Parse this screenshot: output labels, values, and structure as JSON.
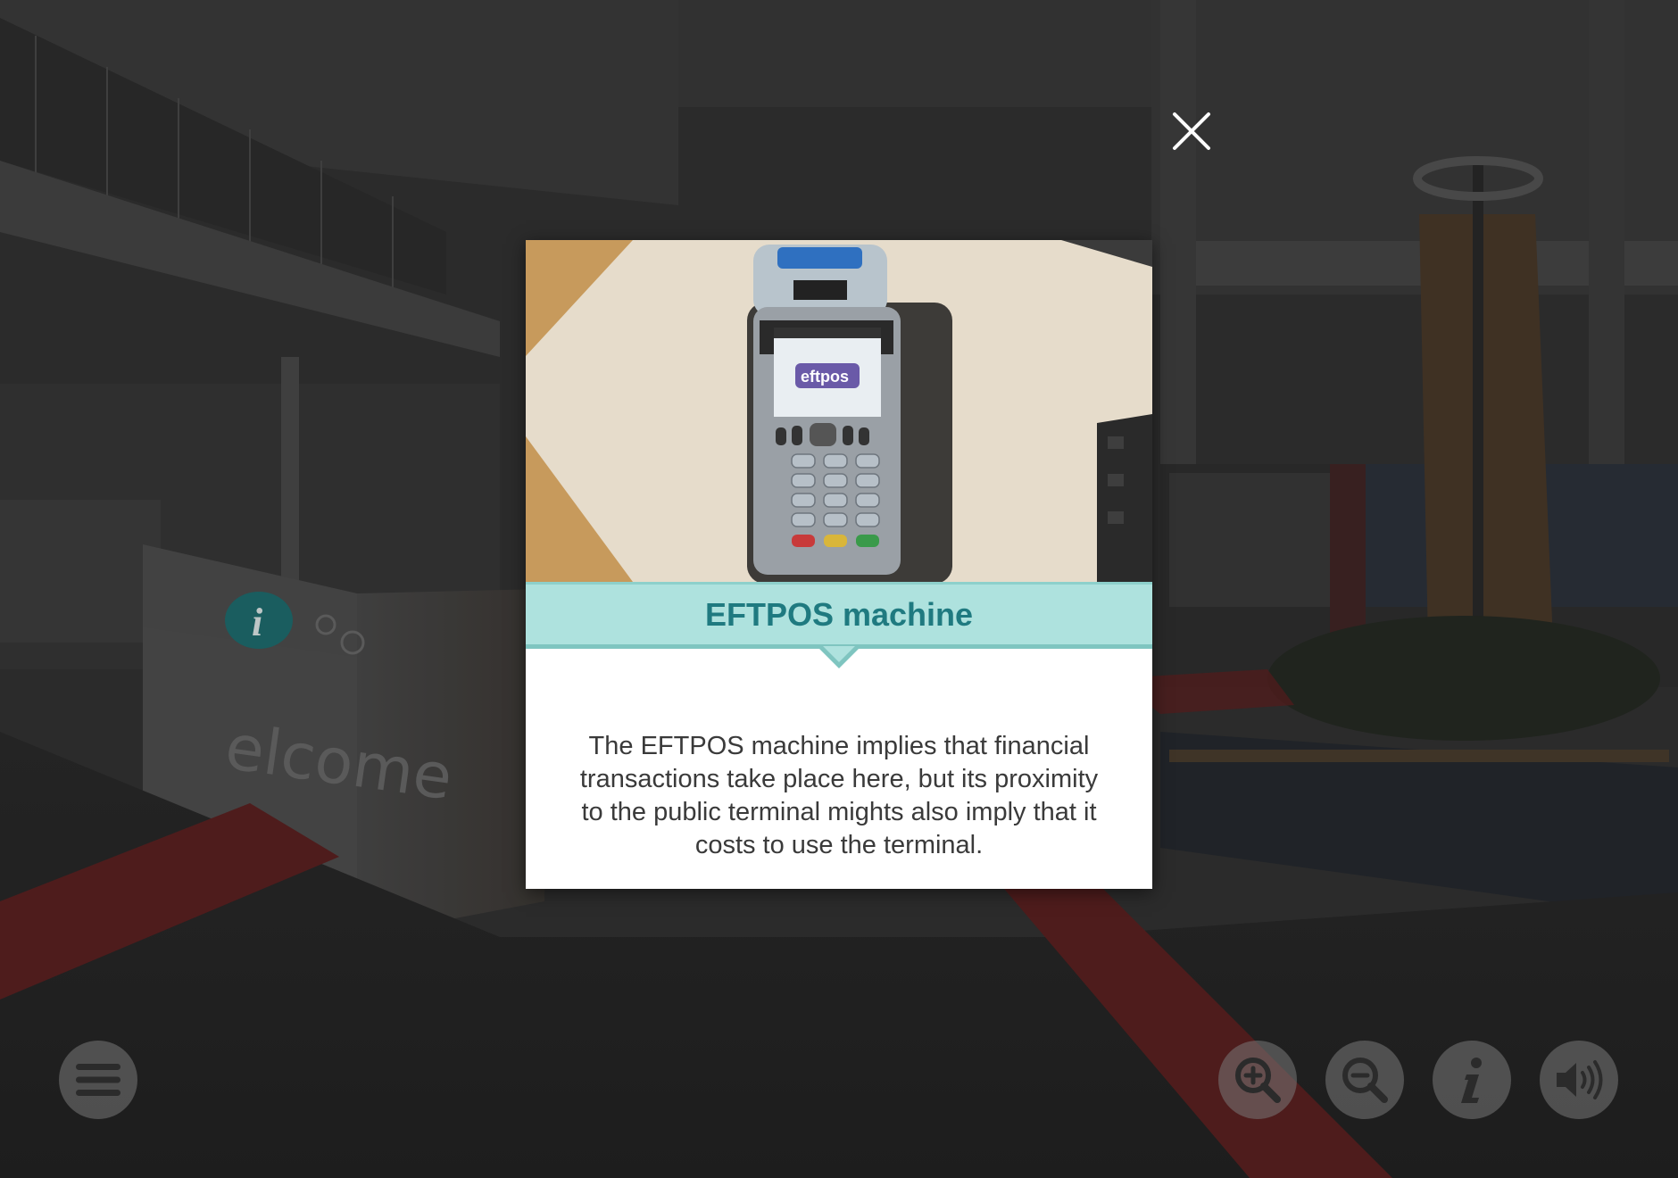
{
  "popup": {
    "title": "EFTPOS machine",
    "description": "The EFTPOS machine implies that financial transactions take place here, but its proximity to the public terminal mights also imply that it costs to use the terminal.",
    "photo_screen_text": "eftpos"
  },
  "scene": {
    "desk_sign_text": "elcome"
  },
  "controls": {
    "menu": "menu-icon",
    "zoom_in": "zoom-in-icon",
    "zoom_out": "zoom-out-icon",
    "info": "info-icon",
    "sound": "sound-icon",
    "close": "close-icon"
  },
  "colors": {
    "title_bar": "#aee2de",
    "title_text": "#1f7a80",
    "control_bg": "#7a7a7a",
    "info_hotspot": "#1f6e70"
  }
}
